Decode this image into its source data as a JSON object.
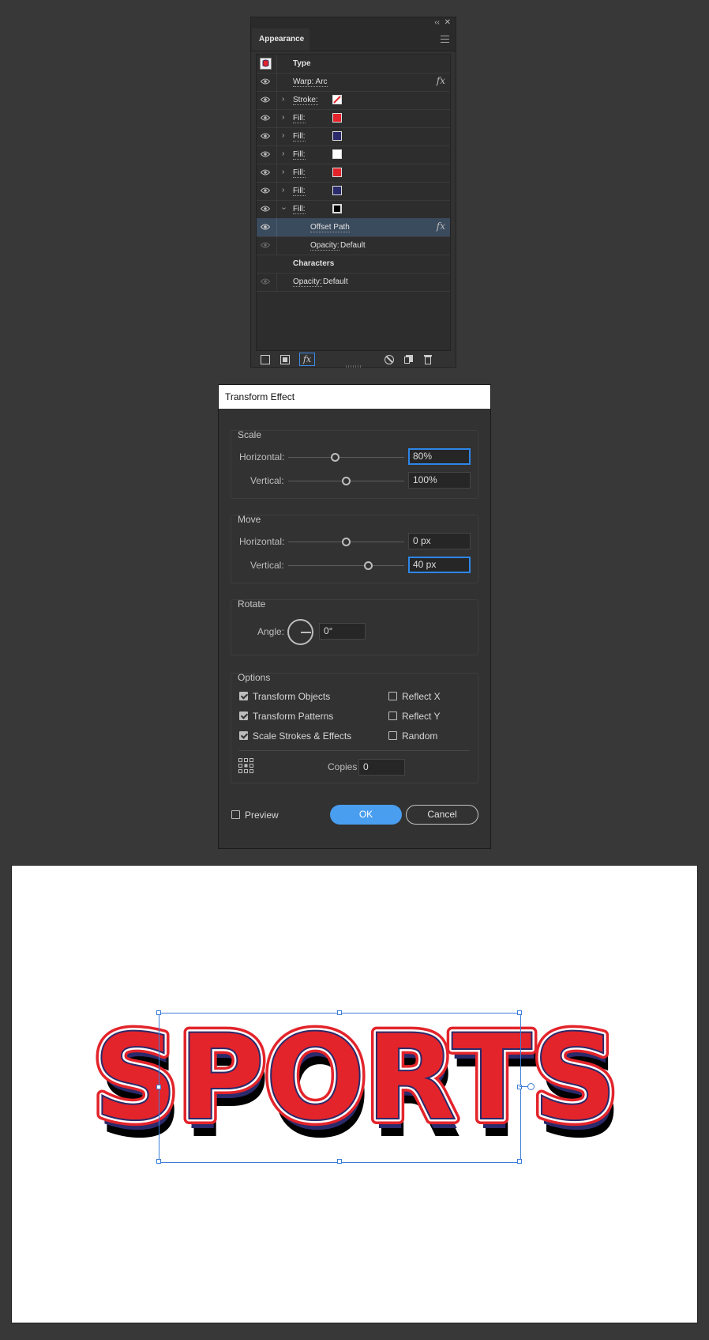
{
  "appearance_panel": {
    "tab_label": "Appearance",
    "collapse_icon": "double-chevron-left",
    "close_icon": "x",
    "menu_icon": "hamburger",
    "header_label": "Type",
    "rows": [
      {
        "label": "Warp: Arc",
        "kind": "effect"
      },
      {
        "label": "Stroke:",
        "kind": "stroke",
        "swatch": "none-red"
      },
      {
        "label": "Fill:",
        "kind": "fill",
        "swatch": "#e3242b"
      },
      {
        "label": "Fill:",
        "kind": "fill",
        "swatch": "#2b2a6b"
      },
      {
        "label": "Fill:",
        "kind": "fill",
        "swatch": "#ffffff"
      },
      {
        "label": "Fill:",
        "kind": "fill",
        "swatch": "#e3242b"
      },
      {
        "label": "Fill:",
        "kind": "fill",
        "swatch": "#2b2a6b"
      },
      {
        "label": "Fill:",
        "kind": "fill",
        "swatch": "#000000",
        "expanded": true
      }
    ],
    "offset_path_label": "Offset Path",
    "opacity_label": "Opacity:",
    "opacity_value": "Default",
    "characters_label": "Characters",
    "fx_label": "fx"
  },
  "transform_dialog": {
    "title": "Transform Effect",
    "scale": {
      "title": "Scale",
      "horizontal_label": "Horizontal:",
      "horizontal_value": "80%",
      "vertical_label": "Vertical:",
      "vertical_value": "100%"
    },
    "move": {
      "title": "Move",
      "horizontal_label": "Horizontal:",
      "horizontal_value": "0 px",
      "vertical_label": "Vertical:",
      "vertical_value": "40 px"
    },
    "rotate": {
      "title": "Rotate",
      "angle_label": "Angle:",
      "angle_value": "0°"
    },
    "options": {
      "title": "Options",
      "transform_objects": "Transform Objects",
      "transform_patterns": "Transform Patterns",
      "scale_strokes": "Scale Strokes & Effects",
      "reflect_x": "Reflect X",
      "reflect_y": "Reflect Y",
      "random": "Random",
      "copies_label": "Copies",
      "copies_value": "0"
    },
    "preview_label": "Preview",
    "ok_label": "OK",
    "cancel_label": "Cancel"
  },
  "artboard": {
    "text": "SPORTS",
    "colors": {
      "face": "#e3242b",
      "outline_inner": "#ffffff",
      "outline_outer": "#2b2a6b",
      "extrude": "#2b2a6b",
      "shadow": "#000000"
    }
  }
}
